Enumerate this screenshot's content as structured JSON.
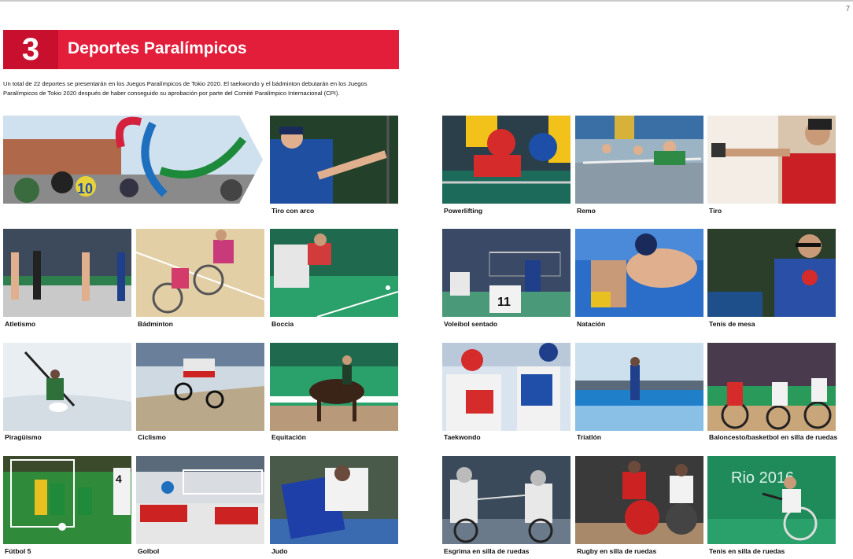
{
  "page_number": "7",
  "section": {
    "number": "3",
    "title": "Deportes Paralímpicos"
  },
  "intro": "Un total de 22 deportes se presentarán en los Juegos Paralímpicos de Tokio 2020. El taekwondo y el bádminton debutarán en los Juegos Paralímpicos de Tokio 2020 después de haber conseguido su aprobación por parte del Comité Paralímpico Internacional (CPI).",
  "sports": [
    {
      "label": "Tiro con arco"
    },
    {
      "label": "Powerlifting"
    },
    {
      "label": "Remo"
    },
    {
      "label": "Tiro"
    },
    {
      "label": "Atletismo"
    },
    {
      "label": "Bádminton"
    },
    {
      "label": "Boccia"
    },
    {
      "label": "Voleibol sentado"
    },
    {
      "label": "Natación"
    },
    {
      "label": "Tenis de mesa"
    },
    {
      "label": "Piragüismo"
    },
    {
      "label": "Ciclismo"
    },
    {
      "label": "Equitación"
    },
    {
      "label": "Taekwondo"
    },
    {
      "label": "Triatlón"
    },
    {
      "label": "Baloncesto/basketbol en silla de ruedas"
    },
    {
      "label": "Fútbol 5"
    },
    {
      "label": "Golbol"
    },
    {
      "label": "Judo"
    },
    {
      "label": "Esgrima en silla de ruedas"
    },
    {
      "label": "Rugby en silla de ruedas"
    },
    {
      "label": "Tenis en silla de ruedas"
    }
  ],
  "photo_text": {
    "olympic_brand": "Rio 2016",
    "jersey_10": "10",
    "jersey_11": "11",
    "jersey_4": "4"
  }
}
